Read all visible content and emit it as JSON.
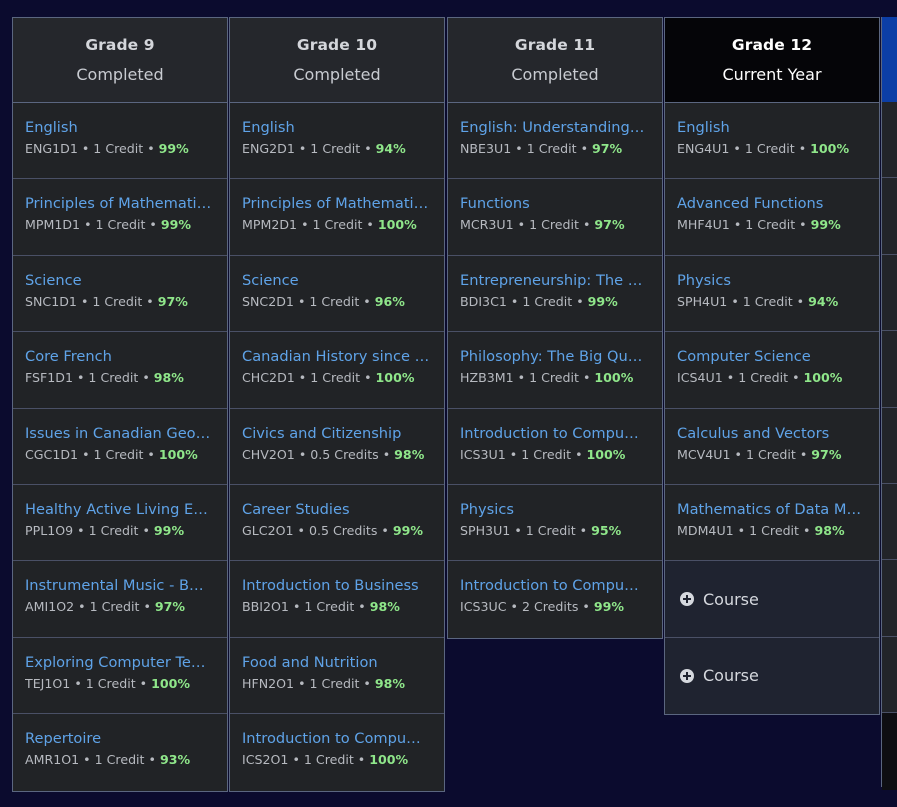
{
  "columns": [
    {
      "title": "Grade 9",
      "status": "Completed",
      "current": false,
      "courses": [
        {
          "name": "English",
          "code": "ENG1D1",
          "credits": "1 Credit",
          "grade": "99%"
        },
        {
          "name": "Principles of Mathemati…",
          "code": "MPM1D1",
          "credits": "1 Credit",
          "grade": "99%"
        },
        {
          "name": "Science",
          "code": "SNC1D1",
          "credits": "1 Credit",
          "grade": "97%"
        },
        {
          "name": "Core French",
          "code": "FSF1D1",
          "credits": "1 Credit",
          "grade": "98%"
        },
        {
          "name": "Issues in Canadian Geo…",
          "code": "CGC1D1",
          "credits": "1 Credit",
          "grade": "100%"
        },
        {
          "name": "Healthy Active Living E…",
          "code": "PPL1O9",
          "credits": "1 Credit",
          "grade": "99%"
        },
        {
          "name": "Instrumental Music - B…",
          "code": "AMI1O2",
          "credits": "1 Credit",
          "grade": "97%"
        },
        {
          "name": "Exploring Computer Te…",
          "code": "TEJ1O1",
          "credits": "1 Credit",
          "grade": "100%"
        },
        {
          "name": "Repertoire",
          "code": "AMR1O1",
          "credits": "1 Credit",
          "grade": "93%"
        }
      ]
    },
    {
      "title": "Grade 10",
      "status": "Completed",
      "current": false,
      "courses": [
        {
          "name": "English",
          "code": "ENG2D1",
          "credits": "1 Credit",
          "grade": "94%"
        },
        {
          "name": "Principles of Mathemati…",
          "code": "MPM2D1",
          "credits": "1 Credit",
          "grade": "100%"
        },
        {
          "name": "Science",
          "code": "SNC2D1",
          "credits": "1 Credit",
          "grade": "96%"
        },
        {
          "name": "Canadian History since …",
          "code": "CHC2D1",
          "credits": "1 Credit",
          "grade": "100%"
        },
        {
          "name": "Civics and Citizenship",
          "code": "CHV2O1",
          "credits": "0.5 Credits",
          "grade": "98%"
        },
        {
          "name": "Career Studies",
          "code": "GLC2O1",
          "credits": "0.5 Credits",
          "grade": "99%"
        },
        {
          "name": "Introduction to Business",
          "code": "BBI2O1",
          "credits": "1 Credit",
          "grade": "98%"
        },
        {
          "name": "Food and Nutrition",
          "code": "HFN2O1",
          "credits": "1 Credit",
          "grade": "98%"
        },
        {
          "name": "Introduction to Compu…",
          "code": "ICS2O1",
          "credits": "1 Credit",
          "grade": "100%"
        }
      ]
    },
    {
      "title": "Grade 11",
      "status": "Completed",
      "current": false,
      "courses": [
        {
          "name": "English: Understanding…",
          "code": "NBE3U1",
          "credits": "1 Credit",
          "grade": "97%"
        },
        {
          "name": "Functions",
          "code": "MCR3U1",
          "credits": "1 Credit",
          "grade": "97%"
        },
        {
          "name": "Entrepreneurship: The …",
          "code": "BDI3C1",
          "credits": "1 Credit",
          "grade": "99%"
        },
        {
          "name": "Philosophy: The Big Qu…",
          "code": "HZB3M1",
          "credits": "1 Credit",
          "grade": "100%"
        },
        {
          "name": "Introduction to Compu…",
          "code": "ICS3U1",
          "credits": "1 Credit",
          "grade": "100%"
        },
        {
          "name": "Physics",
          "code": "SPH3U1",
          "credits": "1 Credit",
          "grade": "95%"
        },
        {
          "name": "Introduction to Compu…",
          "code": "ICS3UC",
          "credits": "2 Credits",
          "grade": "99%"
        }
      ]
    },
    {
      "title": "Grade 12",
      "status": "Current Year",
      "current": true,
      "courses": [
        {
          "name": "English",
          "code": "ENG4U1",
          "credits": "1 Credit",
          "grade": "100%"
        },
        {
          "name": "Advanced Functions",
          "code": "MHF4U1",
          "credits": "1 Credit",
          "grade": "99%"
        },
        {
          "name": "Physics",
          "code": "SPH4U1",
          "credits": "1 Credit",
          "grade": "94%"
        },
        {
          "name": "Computer Science",
          "code": "ICS4U1",
          "credits": "1 Credit",
          "grade": "100%"
        },
        {
          "name": "Calculus and Vectors",
          "code": "MCV4U1",
          "credits": "1 Credit",
          "grade": "97%"
        },
        {
          "name": "Mathematics of Data M…",
          "code": "MDM4U1",
          "credits": "1 Credit",
          "grade": "98%"
        }
      ],
      "add_slots": [
        {
          "label": "Course",
          "icon": "plus-circle-icon"
        },
        {
          "label": "Course",
          "icon": "plus-circle-icon"
        }
      ]
    }
  ],
  "colors": {
    "page_bg": "#0b0b2e",
    "cell_bg": "#212326",
    "link": "#5fa3e8",
    "grade": "#8fe68a",
    "current_header_bg": "#050508",
    "edge_accent": "#0c3ea6"
  }
}
